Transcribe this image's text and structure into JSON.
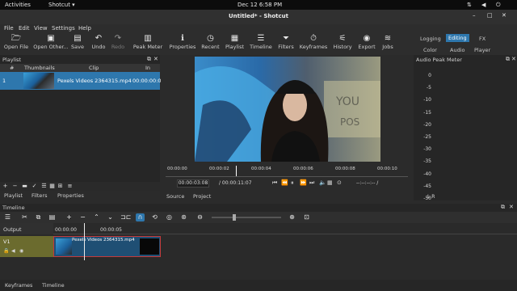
{
  "topbar": {
    "activities": "Activities",
    "app": "Shotcut ▾",
    "clock": "Dec 12  6:58 PM"
  },
  "window": {
    "title": "Untitled* - Shotcut"
  },
  "menu": [
    "File",
    "Edit",
    "View",
    "Settings",
    "Help"
  ],
  "toolbar": {
    "open_file": "Open File",
    "open_other": "Open Other...",
    "save": "Save",
    "undo": "Undo",
    "redo": "Redo",
    "peak_meter": "Peak Meter",
    "properties": "Properties",
    "recent": "Recent",
    "playlist": "Playlist",
    "timeline": "Timeline",
    "filters": "Filters",
    "keyframes": "Keyframes",
    "history": "History",
    "export": "Export",
    "jobs": "Jobs"
  },
  "layouts": {
    "logging": "Logging",
    "editing": "Editing",
    "fx": "FX",
    "color": "Color",
    "audio": "Audio",
    "player": "Player"
  },
  "playlist": {
    "title": "Playlist",
    "headers": {
      "num": "#",
      "thumbnails": "Thumbnails",
      "clip": "Clip",
      "in": "In"
    },
    "row": {
      "num": "1",
      "clip": "Pexels Videos 2364315.mp4",
      "in": "00:00:00:0"
    },
    "tabs": {
      "playlist": "Playlist",
      "filters": "Filters",
      "properties": "Properties"
    }
  },
  "player": {
    "ruler": [
      "00:00:00",
      "00:00:02",
      "00:00:04",
      "00:00:06",
      "00:00:08",
      "00:00:10"
    ],
    "current_time": "00:00:03:08",
    "duration": "/ 00:00:11:07",
    "inout": "--:--:--:-- /",
    "tabs": {
      "source": "Source",
      "project": "Project"
    },
    "progress_fraction": 0.29
  },
  "audio_meter": {
    "title": "Audio Peak Meter",
    "scale": [
      "0",
      "-5",
      "-10",
      "-15",
      "-20",
      "-25",
      "-30",
      "-35",
      "-40",
      "-45",
      "-50"
    ],
    "channels": "L  R"
  },
  "timeline": {
    "title": "Timeline",
    "ruler": [
      "00:00:00",
      "00:00:05"
    ],
    "output_label": "Output",
    "track": "V1",
    "clip_label": "Pexels Videos 2364315.mp4",
    "playhead_fraction": 0.29
  },
  "bottom_tabs": {
    "keyframes": "Keyframes",
    "timeline": "Timeline"
  },
  "colors": {
    "selection": "#2e77ad",
    "track": "#6b6b2e",
    "clip": "#1f4f74",
    "red": "#c43a3a"
  }
}
